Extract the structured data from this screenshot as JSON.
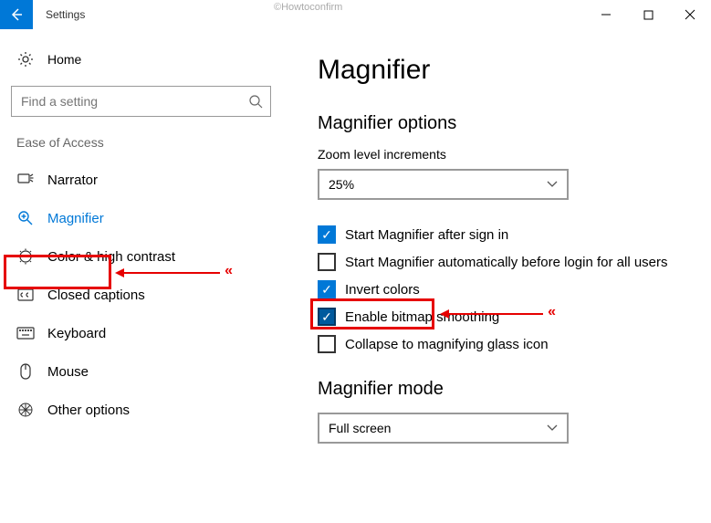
{
  "watermark": "©Howtoconfirm",
  "titlebar": {
    "title": "Settings"
  },
  "sidebar": {
    "home_label": "Home",
    "search_placeholder": "Find a setting",
    "category_label": "Ease of Access",
    "items": [
      {
        "label": "Narrator"
      },
      {
        "label": "Magnifier"
      },
      {
        "label": "Color & high contrast"
      },
      {
        "label": "Closed captions"
      },
      {
        "label": "Keyboard"
      },
      {
        "label": "Mouse"
      },
      {
        "label": "Other options"
      }
    ]
  },
  "main": {
    "page_title": "Magnifier",
    "section_options": "Magnifier options",
    "zoom_label": "Zoom level increments",
    "zoom_value": "25%",
    "checkboxes": [
      {
        "label": "Start Magnifier after sign in"
      },
      {
        "label": "Start Magnifier automatically before login for all users"
      },
      {
        "label": "Invert colors"
      },
      {
        "label": "Enable bitmap smoothing"
      },
      {
        "label": "Collapse to magnifying glass icon"
      }
    ],
    "section_mode": "Magnifier mode",
    "mode_value": "Full screen"
  }
}
